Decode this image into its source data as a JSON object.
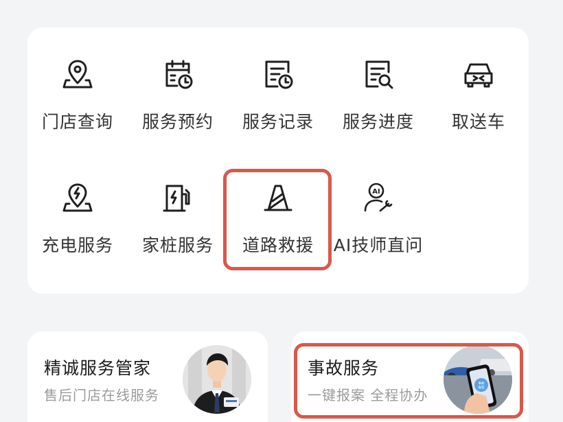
{
  "services": {
    "row1": [
      {
        "label": "门店查询",
        "icon": "store-location-icon"
      },
      {
        "label": "服务预约",
        "icon": "calendar-clock-icon"
      },
      {
        "label": "服务记录",
        "icon": "record-clock-icon"
      },
      {
        "label": "服务进度",
        "icon": "progress-search-icon"
      },
      {
        "label": "取送车",
        "icon": "car-pickup-icon"
      }
    ],
    "row2": [
      {
        "label": "充电服务",
        "icon": "charging-location-icon"
      },
      {
        "label": "家桩服务",
        "icon": "home-charger-icon"
      },
      {
        "label": "道路救援",
        "icon": "traffic-cone-icon"
      },
      {
        "label": "AI技师直问",
        "icon": "ai-technician-icon"
      }
    ]
  },
  "promos": {
    "butler": {
      "title": "精诚服务管家",
      "subtitle": "售后门店在线服务"
    },
    "accident": {
      "title": "事故服务",
      "subtitle": "一键报案 全程协办",
      "phone_badge": "事故报案"
    }
  },
  "colors": {
    "highlight": "#d9584a",
    "icon_stroke": "#1f1f1f",
    "background": "#f3f4f6"
  }
}
